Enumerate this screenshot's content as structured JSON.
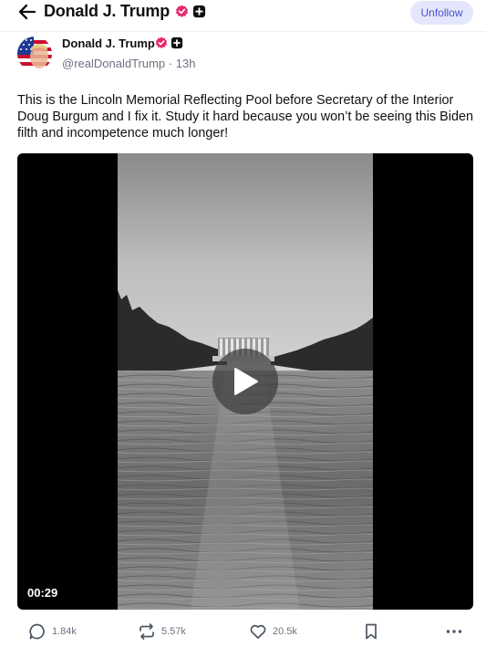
{
  "header": {
    "title": "Donald J. Trump",
    "unfollow_label": "Unfollow"
  },
  "post": {
    "author_name": "Donald J. Trump",
    "handle": "@realDonaldTrump",
    "separator": "·",
    "time_ago": "13h",
    "text": "This is the Lincoln Memorial Reflecting Pool before Secretary of the Interior Doug Burgum and I fix it. Study it hard because you won’t be seeing this Biden filth and incompetence much longer!",
    "video": {
      "duration": "00:29"
    }
  },
  "actions": {
    "replies": "1.84k",
    "reposts": "5.57k",
    "likes": "20.5k"
  },
  "colors": {
    "verified_badge": "#e6286e",
    "unfollow_bg": "#e4e7fb",
    "unfollow_text": "#4b4fcf",
    "muted_text": "#6b7280"
  },
  "icons": {
    "back": "arrow-left-icon",
    "verified": "verified-badge-icon",
    "plus_badge": "plus-badge-icon",
    "play": "play-icon",
    "reply": "comment-icon",
    "repost": "repost-icon",
    "like": "heart-icon",
    "bookmark": "bookmark-icon",
    "more": "more-dots-icon"
  }
}
